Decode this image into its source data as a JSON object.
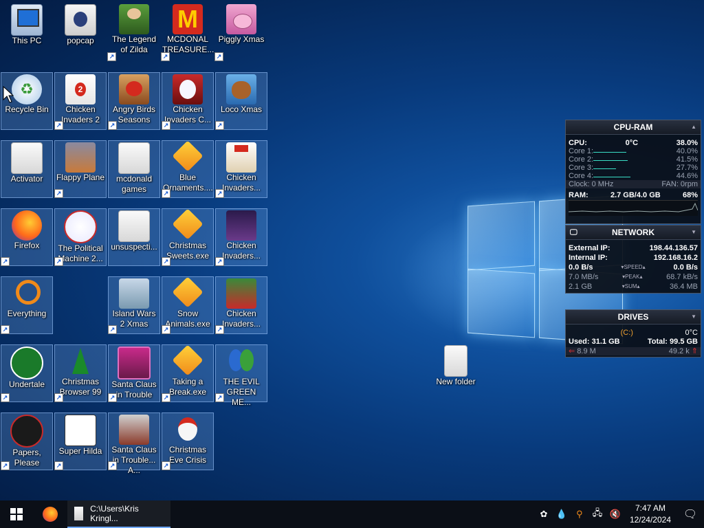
{
  "desktop": {
    "icons": [
      {
        "label": "This PC",
        "shortcut": false
      },
      {
        "label": "popcap",
        "shortcut": false
      },
      {
        "label": "The Legend of Zilda",
        "shortcut": true
      },
      {
        "label": "MCDONAL TREASURE...",
        "shortcut": true
      },
      {
        "label": "Piggly Xmas",
        "shortcut": true
      },
      {
        "label": "Recycle Bin",
        "shortcut": false
      },
      {
        "label": "Chicken Invaders 2",
        "shortcut": true
      },
      {
        "label": "Angry Birds Seasons",
        "shortcut": true
      },
      {
        "label": "Chicken Invaders C...",
        "shortcut": true
      },
      {
        "label": "Loco Xmas",
        "shortcut": true
      },
      {
        "label": "Activator",
        "shortcut": false
      },
      {
        "label": "Flappy Plane",
        "shortcut": true
      },
      {
        "label": "mcdonald games",
        "shortcut": false
      },
      {
        "label": "Blue Ornaments....",
        "shortcut": true
      },
      {
        "label": "Chicken Invaders...",
        "shortcut": true
      },
      {
        "label": "Firefox",
        "shortcut": true
      },
      {
        "label": "The Political Machine 2...",
        "shortcut": true
      },
      {
        "label": "unsuspecti...",
        "shortcut": false
      },
      {
        "label": "Christmas Sweets.exe",
        "shortcut": true
      },
      {
        "label": "Chicken Invaders...",
        "shortcut": true
      },
      {
        "label": "Everything",
        "shortcut": true
      },
      {
        "label": "Island Wars 2 Xmas",
        "shortcut": true
      },
      {
        "label": "Snow Animals.exe",
        "shortcut": true
      },
      {
        "label": "Chicken Invaders...",
        "shortcut": true
      },
      {
        "label": "Undertale",
        "shortcut": true
      },
      {
        "label": "Christmas Browser 99",
        "shortcut": true
      },
      {
        "label": "Santa Claus in Trouble",
        "shortcut": true
      },
      {
        "label": "Taking a Break.exe",
        "shortcut": true
      },
      {
        "label": "THE EVIL GREEN ME...",
        "shortcut": true
      },
      {
        "label": "Papers, Please",
        "shortcut": true
      },
      {
        "label": "Super Hilda",
        "shortcut": true
      },
      {
        "label": "Santa Claus in Trouble... A...",
        "shortcut": true
      },
      {
        "label": "Christmas Eve Crisis",
        "shortcut": true
      },
      {
        "label": "New folder",
        "shortcut": false
      }
    ]
  },
  "cpu_ram": {
    "title": "CPU-RAM",
    "cpu_label": "CPU:",
    "cpu_temp": "0°C",
    "cpu_pct": "38.0%",
    "cores": [
      {
        "label": "Core 1:",
        "pct": "40.0%",
        "level": 0.4
      },
      {
        "label": "Core 2:",
        "pct": "41.5%",
        "level": 0.415
      },
      {
        "label": "Core 3:",
        "pct": "27.7%",
        "level": 0.277
      },
      {
        "label": "Core 4:",
        "pct": "44.6%",
        "level": 0.446
      }
    ],
    "clock": "Clock: 0 MHz",
    "fan": "FAN: 0rpm",
    "ram_label": "RAM:",
    "ram_used": "2.7 GB/4.0 GB",
    "ram_pct": "68%"
  },
  "network": {
    "title": "NETWORK",
    "ext_label": "External IP:",
    "ext_ip": "198.44.136.57",
    "int_label": "Internal IP:",
    "int_ip": "192.168.16.2",
    "rows": [
      {
        "left": "0.0 B/s",
        "mid": "SPEED",
        "right": "0.0 B/s"
      },
      {
        "left": "7.0 MB/s",
        "mid": "PEAK",
        "right": "68.7 kB/s"
      },
      {
        "left": "2.1 GB",
        "mid": "SUM",
        "right": "36.4 MB"
      }
    ]
  },
  "drives": {
    "title": "DRIVES",
    "drive": "(C:)",
    "temp": "0°C",
    "used": "Used: 31.1 GB",
    "total": "Total: 99.5 GB",
    "read": "8.9 M",
    "write": "49.2 k"
  },
  "taskbar": {
    "explorer_title": "C:\\Users\\Kris Kringl...",
    "time": "7:47 AM",
    "date": "12/24/2024"
  }
}
